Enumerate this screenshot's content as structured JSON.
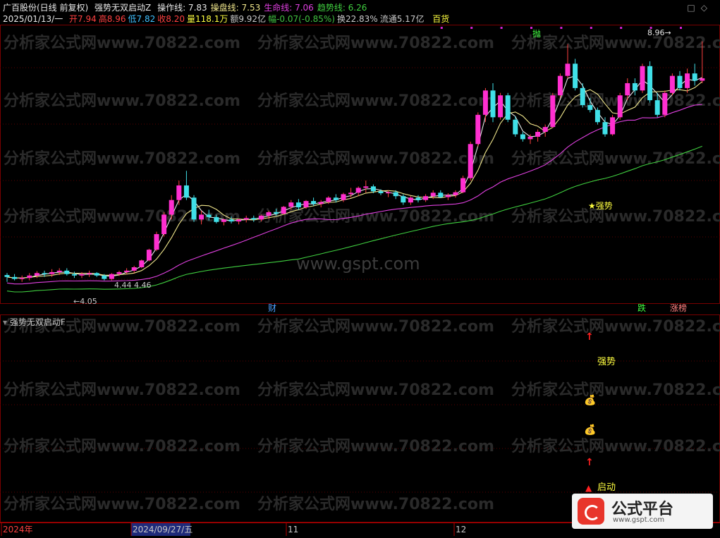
{
  "header": {
    "stock_title": "广百股份(日线 前复权)",
    "indicator_name": "强势无双启动Z",
    "lines": [
      {
        "label": "操作线:",
        "value": "7.83",
        "color": "#e8e8e8"
      },
      {
        "label": "操盘线:",
        "value": "7.53",
        "color": "#f0e68c"
      },
      {
        "label": "生命线:",
        "value": "7.06",
        "color": "#e040e0"
      },
      {
        "label": "趋势线:",
        "value": "6.26",
        "color": "#40d040"
      }
    ],
    "date": "2025/01/13/一",
    "quote": [
      {
        "label": "开",
        "value": "7.94",
        "color": "#ff4040"
      },
      {
        "label": "高",
        "value": "8.96",
        "color": "#ff4040"
      },
      {
        "label": "低",
        "value": "7.82",
        "color": "#40c0ff"
      },
      {
        "label": "收",
        "value": "8.20",
        "color": "#ff4040"
      },
      {
        "label": "量",
        "value": "118.1万",
        "color": "#ffff40"
      },
      {
        "label": "额",
        "value": "9.92亿",
        "color": "#c8c8c8"
      },
      {
        "label": "幅",
        "value": "-0.07(-0.85%)",
        "color": "#40c040"
      },
      {
        "label": "换",
        "value": "22.83%",
        "color": "#c8c8c8"
      },
      {
        "label": "流通",
        "value": "5.17亿",
        "color": "#c8c8c8"
      }
    ],
    "sector": "百货"
  },
  "subpanel": {
    "title": "强势无双启动F",
    "label_strong": "强势",
    "label_start": "启动"
  },
  "chart_data": {
    "type": "candlestick",
    "title": "广百股份(日线 前复权)",
    "indicator": "强势无双启动Z",
    "ylim": [
      3.9,
      9.2
    ],
    "candles": [
      [
        4.16,
        4.2,
        4.02,
        4.12
      ],
      [
        4.12,
        4.18,
        4.05,
        4.08
      ],
      [
        4.08,
        4.15,
        4.02,
        4.1
      ],
      [
        4.1,
        4.2,
        4.05,
        4.15
      ],
      [
        4.15,
        4.24,
        4.1,
        4.2
      ],
      [
        4.2,
        4.25,
        4.12,
        4.18
      ],
      [
        4.18,
        4.28,
        4.12,
        4.22
      ],
      [
        4.22,
        4.3,
        4.16,
        4.25
      ],
      [
        4.25,
        4.3,
        4.15,
        4.18
      ],
      [
        4.18,
        4.23,
        4.1,
        4.15
      ],
      [
        4.15,
        4.22,
        4.1,
        4.18
      ],
      [
        4.18,
        4.25,
        4.12,
        4.2
      ],
      [
        4.2,
        4.22,
        4.12,
        4.15
      ],
      [
        4.15,
        4.18,
        4.05,
        4.08
      ],
      [
        4.08,
        4.2,
        4.05,
        4.18
      ],
      [
        4.18,
        4.25,
        4.14,
        4.22
      ],
      [
        4.22,
        4.3,
        4.18,
        4.25
      ],
      [
        4.25,
        4.35,
        4.2,
        4.32
      ],
      [
        4.32,
        4.48,
        4.3,
        4.46
      ],
      [
        4.46,
        4.7,
        4.44,
        4.68
      ],
      [
        4.68,
        5.05,
        4.65,
        5.0
      ],
      [
        5.0,
        5.45,
        4.95,
        5.4
      ],
      [
        5.4,
        5.8,
        5.3,
        5.7
      ],
      [
        5.7,
        6.1,
        5.6,
        6.0
      ],
      [
        6.0,
        6.3,
        5.7,
        5.75
      ],
      [
        5.75,
        5.8,
        5.25,
        5.3
      ],
      [
        5.3,
        5.48,
        5.2,
        5.4
      ],
      [
        5.4,
        5.5,
        5.28,
        5.35
      ],
      [
        5.35,
        5.4,
        5.22,
        5.25
      ],
      [
        5.25,
        5.32,
        5.18,
        5.3
      ],
      [
        5.3,
        5.36,
        5.22,
        5.26
      ],
      [
        5.26,
        5.32,
        5.2,
        5.3
      ],
      [
        5.3,
        5.38,
        5.24,
        5.33
      ],
      [
        5.33,
        5.38,
        5.25,
        5.3
      ],
      [
        5.3,
        5.4,
        5.26,
        5.38
      ],
      [
        5.38,
        5.48,
        5.32,
        5.45
      ],
      [
        5.45,
        5.52,
        5.38,
        5.42
      ],
      [
        5.42,
        5.58,
        5.4,
        5.56
      ],
      [
        5.56,
        5.7,
        5.5,
        5.65
      ],
      [
        5.65,
        5.72,
        5.5,
        5.55
      ],
      [
        5.55,
        5.7,
        5.52,
        5.68
      ],
      [
        5.68,
        5.75,
        5.58,
        5.62
      ],
      [
        5.62,
        5.7,
        5.55,
        5.66
      ],
      [
        5.66,
        5.78,
        5.62,
        5.75
      ],
      [
        5.75,
        5.82,
        5.65,
        5.7
      ],
      [
        5.7,
        5.85,
        5.66,
        5.82
      ],
      [
        5.82,
        5.95,
        5.75,
        5.85
      ],
      [
        5.85,
        5.98,
        5.78,
        5.95
      ],
      [
        5.95,
        6.1,
        5.85,
        5.98
      ],
      [
        5.98,
        6.02,
        5.84,
        5.88
      ],
      [
        5.88,
        5.92,
        5.8,
        5.84
      ],
      [
        5.84,
        5.9,
        5.76,
        5.86
      ],
      [
        5.86,
        5.9,
        5.72,
        5.78
      ],
      [
        5.78,
        5.82,
        5.6,
        5.65
      ],
      [
        5.65,
        5.78,
        5.6,
        5.75
      ],
      [
        5.75,
        5.8,
        5.65,
        5.7
      ],
      [
        5.7,
        5.82,
        5.66,
        5.78
      ],
      [
        5.78,
        5.9,
        5.72,
        5.85
      ],
      [
        5.85,
        5.9,
        5.74,
        5.76
      ],
      [
        5.76,
        5.84,
        5.7,
        5.8
      ],
      [
        5.8,
        5.9,
        5.75,
        5.86
      ],
      [
        5.86,
        6.2,
        5.84,
        6.15
      ],
      [
        6.15,
        6.9,
        6.1,
        6.85
      ],
      [
        6.85,
        7.5,
        6.8,
        7.45
      ],
      [
        7.45,
        8.0,
        7.3,
        7.95
      ],
      [
        7.95,
        8.1,
        7.3,
        7.4
      ],
      [
        7.4,
        7.9,
        7.35,
        7.85
      ],
      [
        7.85,
        7.9,
        7.3,
        7.35
      ],
      [
        7.35,
        7.42,
        7.0,
        7.05
      ],
      [
        7.05,
        7.1,
        6.9,
        6.95
      ],
      [
        6.95,
        7.05,
        6.85,
        7.0
      ],
      [
        7.0,
        7.15,
        6.9,
        7.1
      ],
      [
        7.1,
        7.25,
        7.0,
        7.2
      ],
      [
        7.2,
        7.9,
        7.18,
        7.85
      ],
      [
        7.85,
        8.3,
        7.8,
        8.25
      ],
      [
        8.25,
        8.9,
        8.2,
        8.5
      ],
      [
        8.5,
        8.6,
        7.95,
        8.0
      ],
      [
        8.0,
        8.1,
        7.6,
        7.65
      ],
      [
        7.65,
        7.8,
        7.5,
        7.55
      ],
      [
        7.55,
        7.6,
        7.25,
        7.3
      ],
      [
        7.3,
        7.4,
        7.0,
        7.05
      ],
      [
        7.05,
        7.45,
        7.02,
        7.4
      ],
      [
        7.4,
        7.9,
        7.35,
        7.85
      ],
      [
        7.85,
        8.2,
        7.75,
        8.1
      ],
      [
        8.1,
        8.2,
        7.85,
        7.95
      ],
      [
        7.95,
        8.5,
        7.9,
        8.45
      ],
      [
        8.45,
        8.55,
        7.7,
        7.75
      ],
      [
        7.75,
        7.9,
        7.4,
        7.45
      ],
      [
        7.45,
        7.95,
        7.4,
        7.9
      ],
      [
        7.9,
        8.3,
        7.85,
        8.25
      ],
      [
        8.25,
        8.35,
        7.95,
        8.0
      ],
      [
        8.0,
        8.4,
        7.9,
        8.3
      ],
      [
        8.3,
        8.5,
        8.05,
        8.15
      ],
      [
        8.15,
        8.96,
        8.1,
        8.2
      ]
    ],
    "extra_candles": [
      [
        7.82,
        8.96,
        7.82,
        8.2
      ]
    ],
    "marks": {
      "low": "4.05",
      "mid_low": "4.44",
      "mid_high": "4.46",
      "high": "8.96",
      "sell_tag": "抛",
      "strong_tag": "强势"
    },
    "bottom_tags": {
      "finance": "财",
      "down": "跌",
      "up_rank": "涨榜"
    },
    "time_axis": [
      "2024年",
      "2024/09/27/五",
      "11",
      "12"
    ],
    "watermark_text": "分析家公式网www.70822.com",
    "center_watermark": "www.gspt.com",
    "legend": [
      {
        "name": "操作线",
        "color": "#e8e8e8"
      },
      {
        "name": "操盘线",
        "color": "#f0e68c"
      },
      {
        "name": "生命线",
        "color": "#e040e0"
      },
      {
        "name": "趋势线",
        "color": "#40d040"
      }
    ]
  },
  "brand": {
    "name": "公式平台",
    "url": "www.gspt.com"
  },
  "colors": {
    "up": "#ff2fd0",
    "down": "#40e0e8",
    "bg": "#000000",
    "grid": "#7a0000"
  }
}
